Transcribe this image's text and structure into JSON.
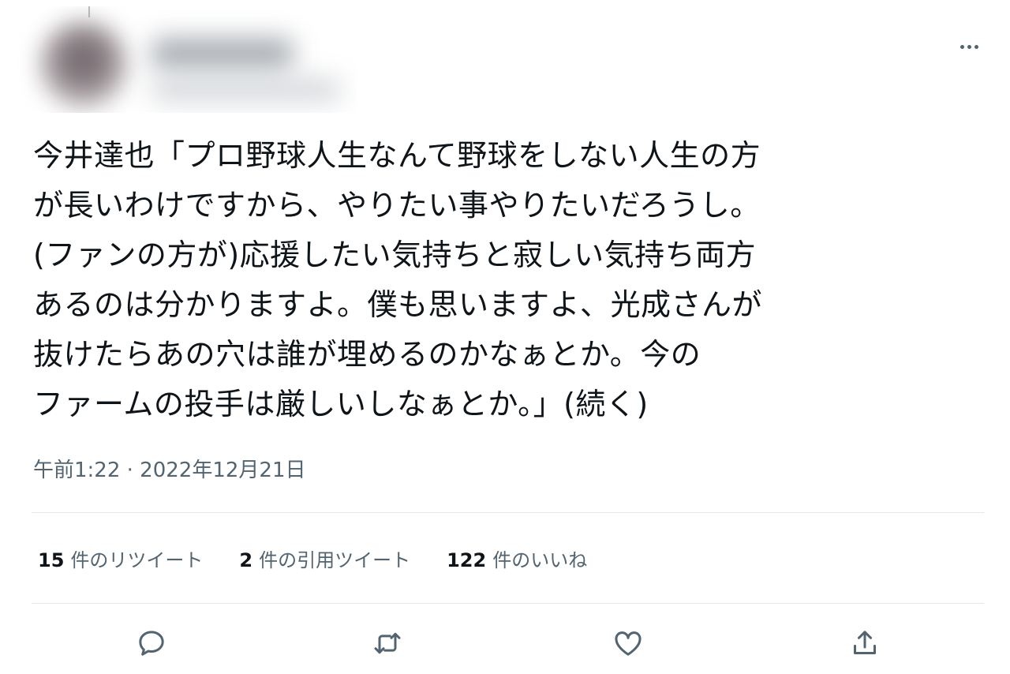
{
  "tweet": {
    "text_lines": [
      "今井達也「プロ野球人生なんて野球をしない人生の方",
      "が長いわけですから、やりたい事やりたいだろうし。",
      "(ファンの方が)応援したい気持ちと寂しい気持ち両方",
      "あるのは分かりますよ。僕も思いますよ、光成さんが",
      "抜けたらあの穴は誰が埋めるのかなぁとか。今の",
      "ファームの投手は厳しいしなぁとか。」(続く)"
    ],
    "timestamp": "午前1:22 · 2022年12月21日"
  },
  "stats": [
    {
      "count": "15",
      "label": "件のリツイート"
    },
    {
      "count": "2",
      "label": "件の引用ツイート"
    },
    {
      "count": "122",
      "label": "件のいいね"
    }
  ],
  "actions": {
    "reply_icon": "reply-icon",
    "retweet_icon": "retweet-icon",
    "like_icon": "heart-icon",
    "share_icon": "share-icon",
    "more_icon": "more-icon"
  },
  "colors": {
    "text": "#0f1419",
    "secondary": "#536471",
    "divider": "#e4e8eb"
  }
}
